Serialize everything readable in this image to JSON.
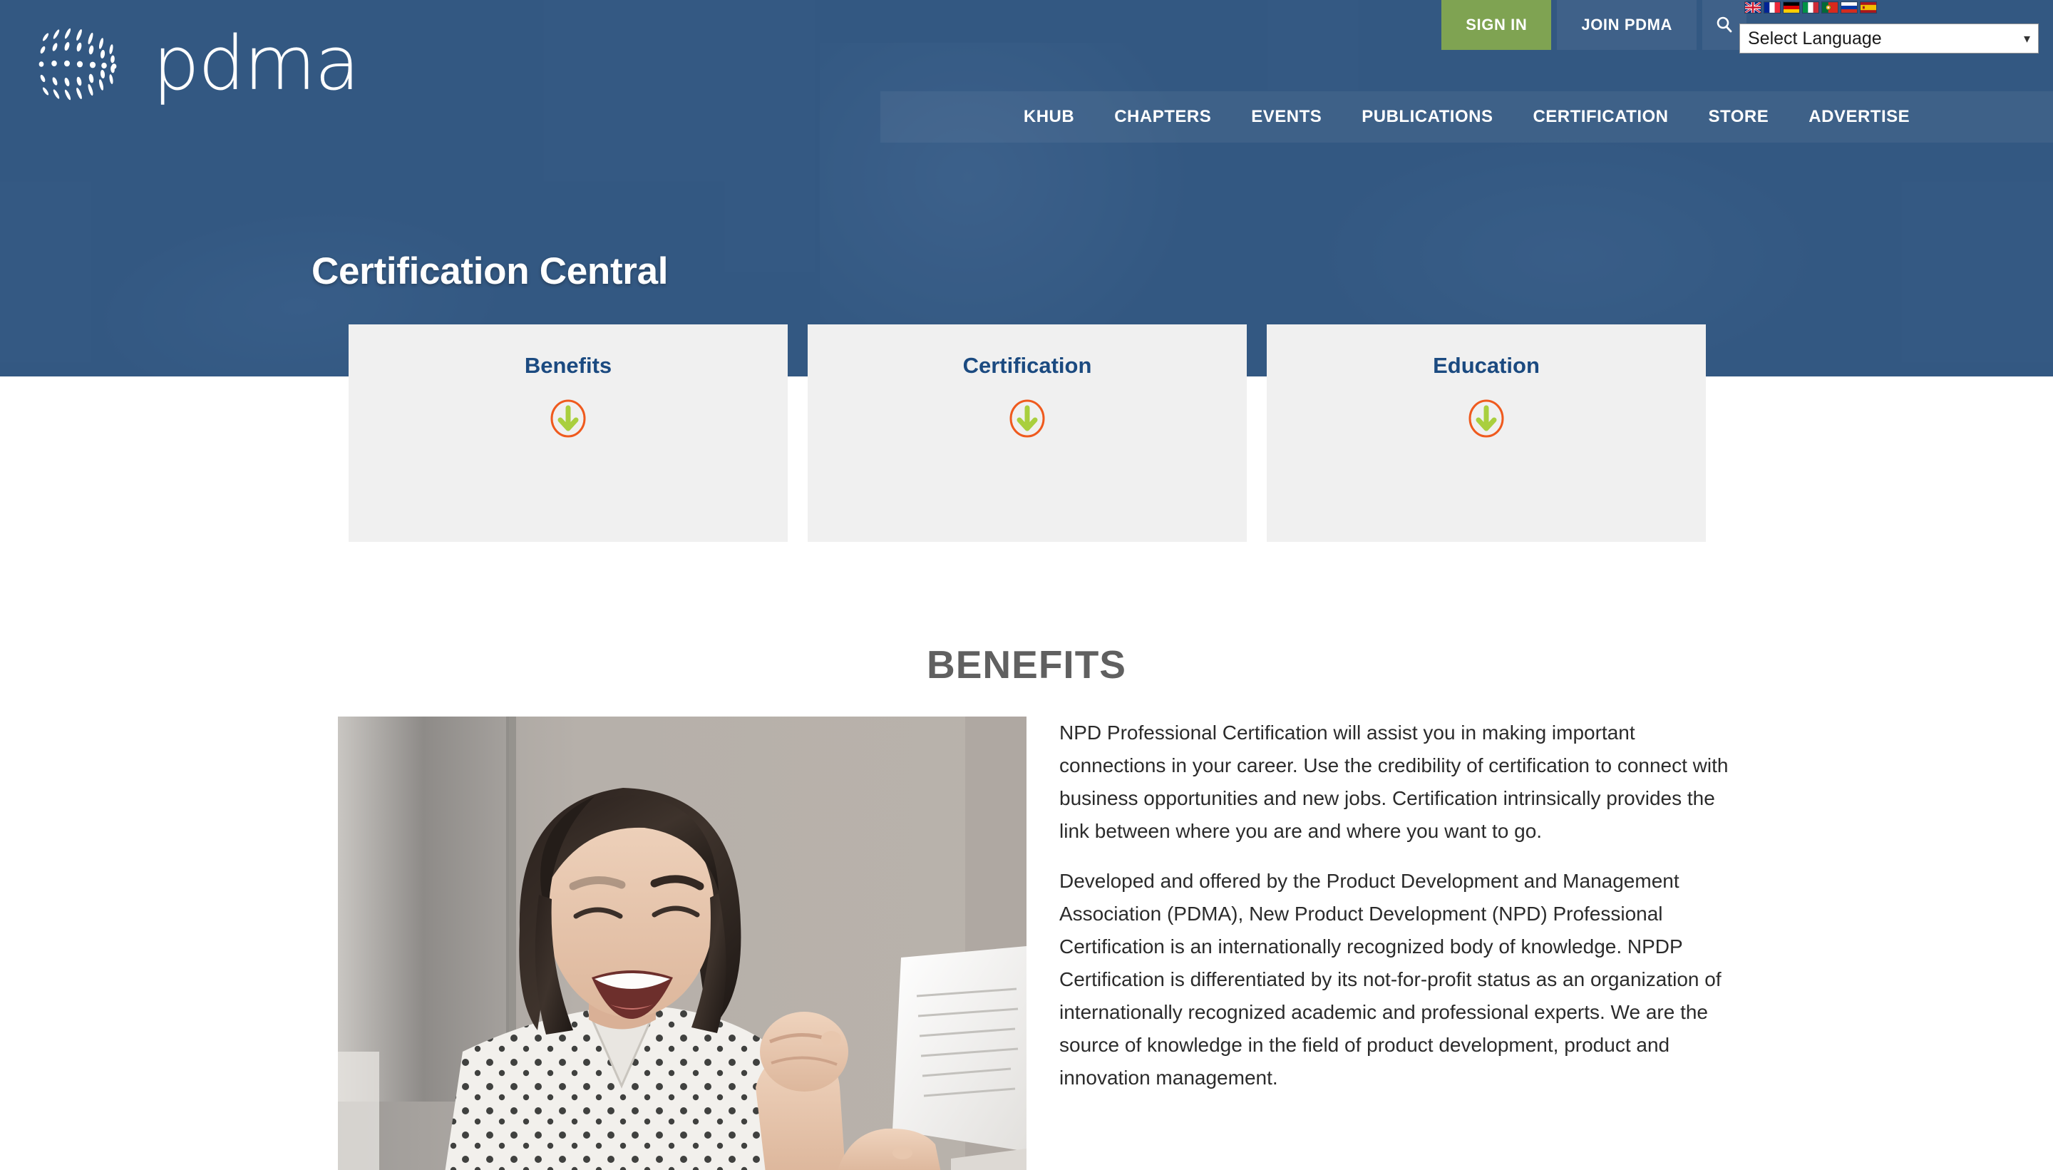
{
  "header": {
    "logo_alt": "pdma",
    "sign_in_label": "SIGN IN",
    "join_label": "JOIN PDMA",
    "search_icon": "search-icon",
    "language_select_value": "Select Language",
    "flags": [
      {
        "name": "flag-united-kingdom"
      },
      {
        "name": "flag-france"
      },
      {
        "name": "flag-germany"
      },
      {
        "name": "flag-italy"
      },
      {
        "name": "flag-portugal"
      },
      {
        "name": "flag-russia"
      },
      {
        "name": "flag-spain"
      }
    ],
    "nav": [
      {
        "label": "KHUB"
      },
      {
        "label": "CHAPTERS"
      },
      {
        "label": "EVENTS"
      },
      {
        "label": "PUBLICATIONS"
      },
      {
        "label": "CERTIFICATION"
      },
      {
        "label": "STORE"
      },
      {
        "label": "ADVERTISE"
      }
    ]
  },
  "hero": {
    "title": "Certification Central"
  },
  "cards": [
    {
      "title": "Benefits",
      "arrow_icon": "circle-arrow-down-icon"
    },
    {
      "title": "Certification",
      "arrow_icon": "circle-arrow-down-icon"
    },
    {
      "title": "Education",
      "arrow_icon": "circle-arrow-down-icon"
    }
  ],
  "benefits": {
    "heading": "BENEFITS",
    "image_alt": "woman-celebrating-reading-document",
    "paragraphs": [
      "NPD Professional Certification will assist you in making important connections in your career. Use the credibility of certification to connect with business opportunities and new jobs. Certification intrinsically provides the link between where you are and where you want to go.",
      "Developed and offered by the Product Development and Management Association (PDMA), New Product Development (NPD) Professional Certification is an internationally recognized body of knowledge. NPDP Certification is differentiated by its not-for-profit status as an organization of internationally recognized academic and professional experts. We are the source of knowledge in the field of product development, product and innovation management."
    ]
  },
  "colors": {
    "brand_blue": "#355a85",
    "accent_green": "#7fa352",
    "arrow_orange": "#ef5a1e",
    "arrow_green": "#a9cf3e",
    "card_bg": "#f0f0f0",
    "title_blue": "#1b4a80"
  }
}
